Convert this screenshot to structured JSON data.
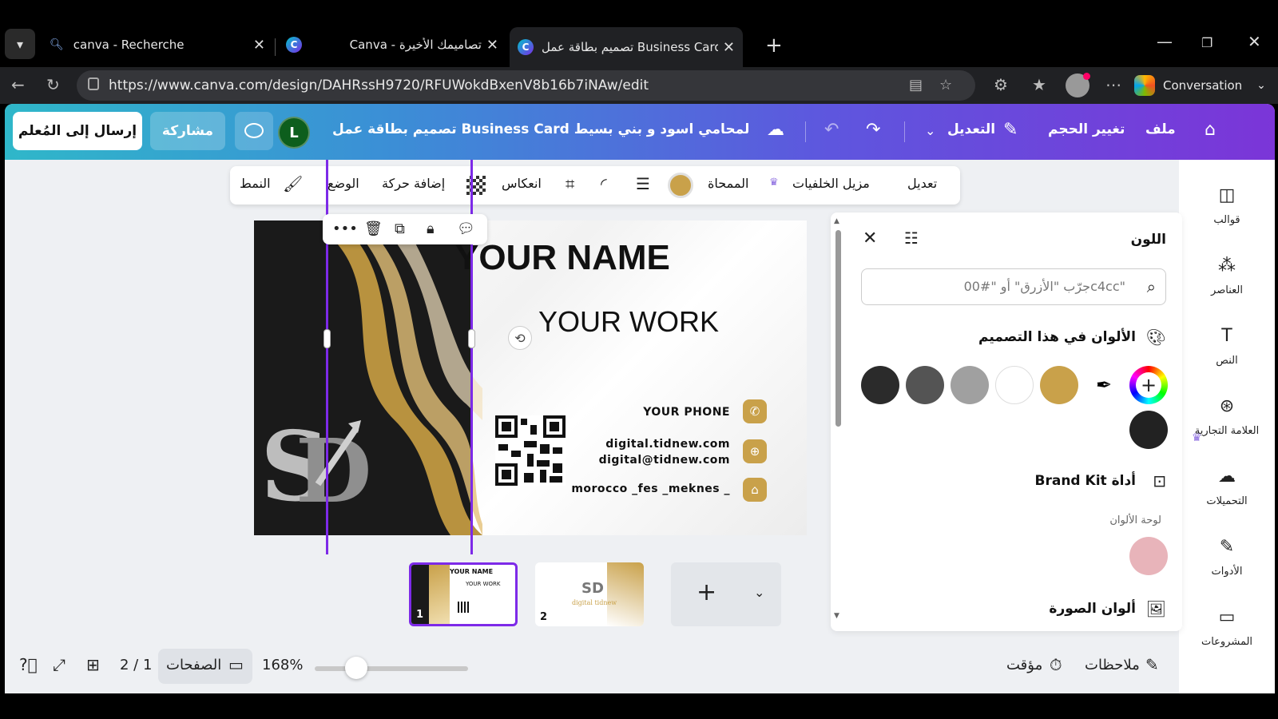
{
  "browser": {
    "tabs": [
      {
        "title": "canva - Recherche",
        "active": false
      },
      {
        "title": "Canva - تصاميمك الأخيرة",
        "active": false
      },
      {
        "title": "تصميم بطاقة عمل Business Card لـ",
        "active": true
      }
    ],
    "url": "https://www.canva.com/design/DAHRssH9720/RFUWokdBxenV8b16b7iNAw/edit",
    "conversation_label": "Conversation"
  },
  "topbar": {
    "send_label": "إرسال إلى المُعلم",
    "share_label": "مشاركة",
    "user_initial": "L",
    "doc_title": "تصميم بطاقة عمل Business Card لمحامي اسود و بني بسيط",
    "edit_label": "التعديل",
    "resize_label": "تغيير الحجم",
    "file_label": "ملف"
  },
  "rail": [
    {
      "label": "قوالب",
      "icon": "templates-icon"
    },
    {
      "label": "العناصر",
      "icon": "elements-icon"
    },
    {
      "label": "النص",
      "icon": "text-icon"
    },
    {
      "label": "العلامة التجارية",
      "icon": "brand-icon"
    },
    {
      "label": "التحميلات",
      "icon": "uploads-icon"
    },
    {
      "label": "الأدوات",
      "icon": "tools-icon"
    },
    {
      "label": "المشروعات",
      "icon": "projects-icon"
    }
  ],
  "toolbar": {
    "edit": "تعديل",
    "bg_remover": "مزيل الخلفيات",
    "eraser": "الممحاة",
    "flip": "انعكاس",
    "animate": "إضافة حركة",
    "position": "الوضع",
    "style": "النمط",
    "selected_color": "#c9a14a"
  },
  "card": {
    "name": "YOUR NAME",
    "work": "YOUR WORK",
    "phone": "YOUR PHONE",
    "website": "digital.tidnew.com",
    "email": "digital@tidnew.com",
    "address": "morocco _fes _meknes _"
  },
  "thumbnails": [
    {
      "num": "1",
      "name": "YOUR NAME",
      "work": "YOUR WORK",
      "selected": true
    },
    {
      "num": "2",
      "brand": "digital tidnew",
      "selected": false
    }
  ],
  "color_panel": {
    "title": "اللون",
    "search_placeholder": "جرّب \"الأزرق\" أو \"#00c4cc\"",
    "design_colors_title": "الألوان في هذا التصميم",
    "design_colors": [
      "#2b2b2b",
      "#545454",
      "#a0a0a0",
      "#ffffff",
      "#c9a14a"
    ],
    "extra_color": "#222222",
    "brand_kit_title": "Brand Kit أداة",
    "palette_label": "لوحة الألوان",
    "palette_color": "#e8b4ba",
    "photo_colors_title": "ألوان الصورة"
  },
  "status": {
    "notes": "ملاحظات",
    "timer": "مؤقت",
    "zoom": "168%",
    "zoom_fraction": 0.27,
    "pages": "الصفحات",
    "page_count": "2 / 1"
  }
}
